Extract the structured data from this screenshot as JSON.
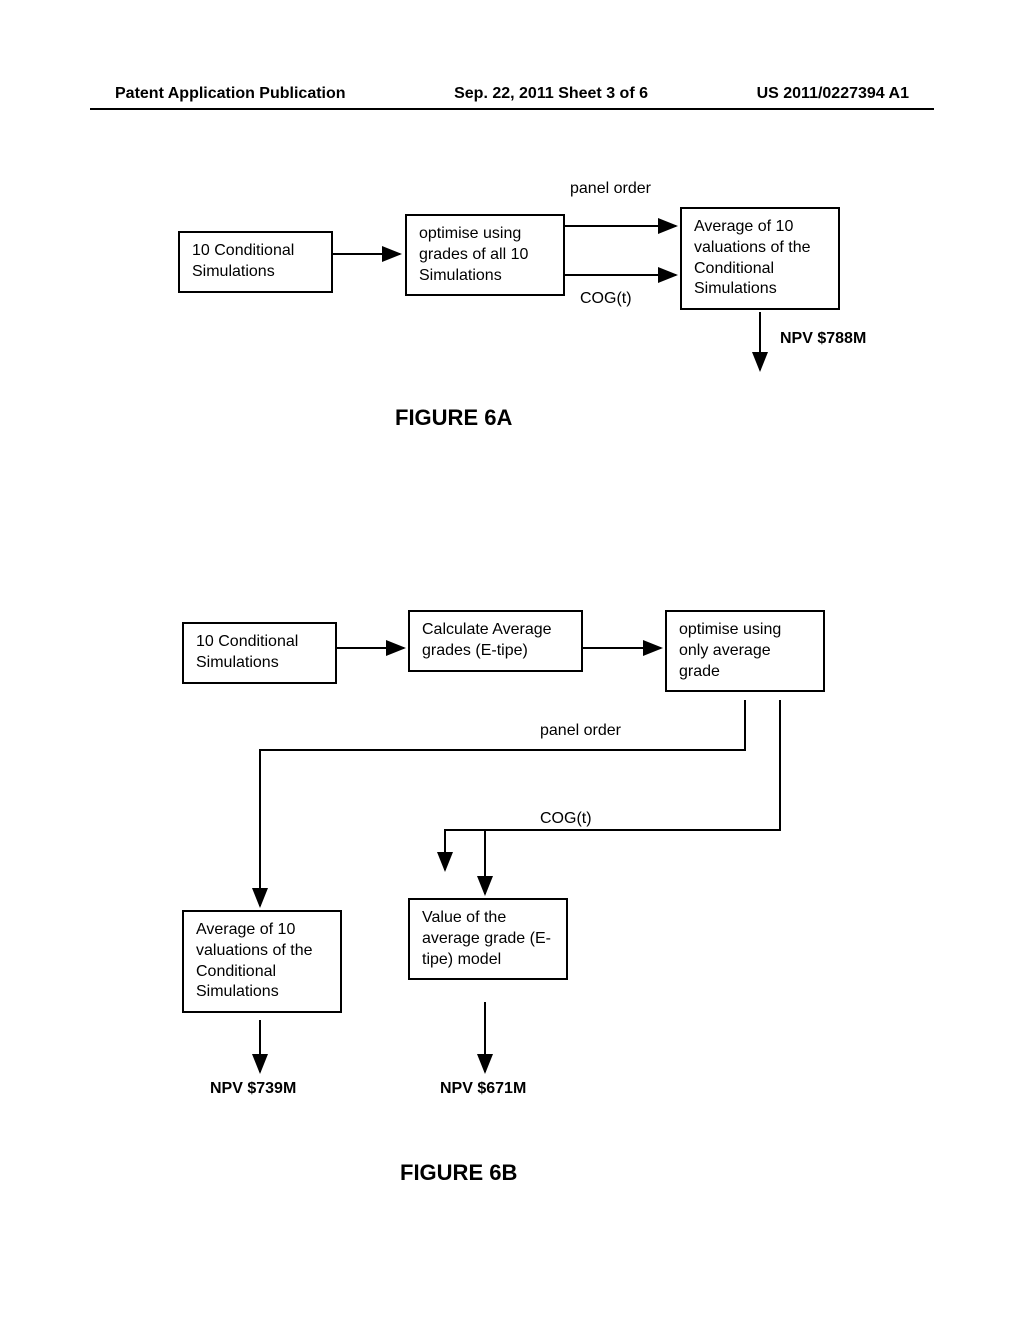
{
  "header": {
    "left": "Patent Application Publication",
    "center": "Sep. 22, 2011  Sheet 3 of 6",
    "right": "US 2011/0227394 A1"
  },
  "figure6a": {
    "box1": "10 Conditional Simulations",
    "box2": "optimise using grades of all 10 Simulations",
    "box3": "Average of 10 valuations of the Conditional Simulations",
    "label_panel_order": "panel order",
    "label_cog": "COG(t)",
    "label_npv": "NPV $788M",
    "title": "FIGURE 6A"
  },
  "figure6b": {
    "box1": "10 Conditional Simulations",
    "box2": "Calculate Average grades (E-tipe)",
    "box3": "optimise using only average grade",
    "box4": "Average of 10 valuations of the Conditional Simulations",
    "box5": "Value of the average grade (E-tipe) model",
    "label_panel_order": "panel order",
    "label_cog": "COG(t)",
    "label_npv1": "NPV $739M",
    "label_npv2": "NPV $671M",
    "title": "FIGURE 6B"
  }
}
